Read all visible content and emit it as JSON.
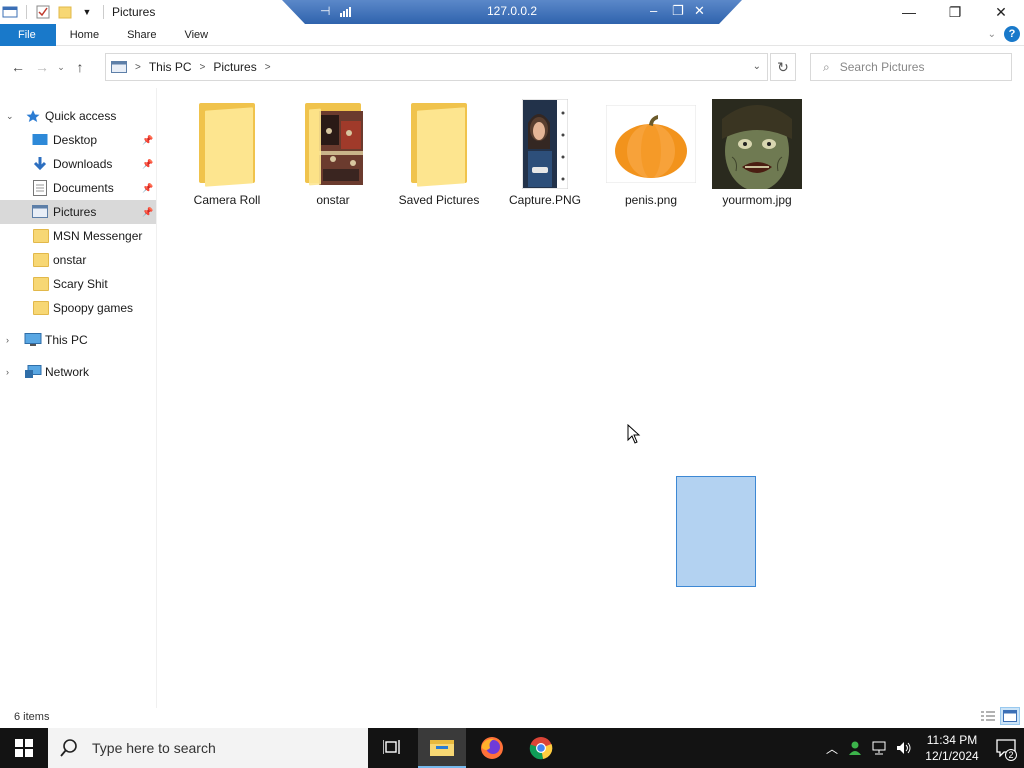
{
  "window": {
    "title": "Pictures",
    "rdp_host": "127.0.0.2"
  },
  "ribbon": {
    "tabs": [
      "File",
      "Home",
      "Share",
      "View"
    ]
  },
  "address": {
    "crumbs": [
      "This PC",
      "Pictures"
    ],
    "search_placeholder": "Search Pictures"
  },
  "sidebar": {
    "quick_access": "Quick access",
    "items": [
      {
        "label": "Desktop",
        "icon": "desktop-icon",
        "pinned": true
      },
      {
        "label": "Downloads",
        "icon": "download-icon",
        "pinned": true
      },
      {
        "label": "Documents",
        "icon": "documents-icon",
        "pinned": true
      },
      {
        "label": "Pictures",
        "icon": "pictures-icon",
        "pinned": true,
        "selected": true
      },
      {
        "label": "MSN Messenger",
        "icon": "folder-icon"
      },
      {
        "label": "onstar",
        "icon": "folder-icon"
      },
      {
        "label": "Scary Shit",
        "icon": "folder-icon"
      },
      {
        "label": "Spoopy games",
        "icon": "folder-icon"
      }
    ],
    "this_pc": "This PC",
    "network": "Network"
  },
  "files": [
    {
      "name": "Camera Roll",
      "type": "folder"
    },
    {
      "name": "onstar",
      "type": "folder-with-preview"
    },
    {
      "name": "Saved Pictures",
      "type": "folder"
    },
    {
      "name": "Capture.PNG",
      "type": "image"
    },
    {
      "name": "penis.png",
      "type": "image"
    },
    {
      "name": "yourmom.jpg",
      "type": "image"
    }
  ],
  "status": {
    "item_count": "6 items"
  },
  "taskbar": {
    "search_placeholder": "Type here to search",
    "time": "11:34 PM",
    "date": "12/1/2024",
    "notification_count": "2"
  },
  "colors": {
    "accent": "#1979ca",
    "selection": "#b3d2f1",
    "folder": "#f7d774",
    "taskbar": "#131313"
  }
}
